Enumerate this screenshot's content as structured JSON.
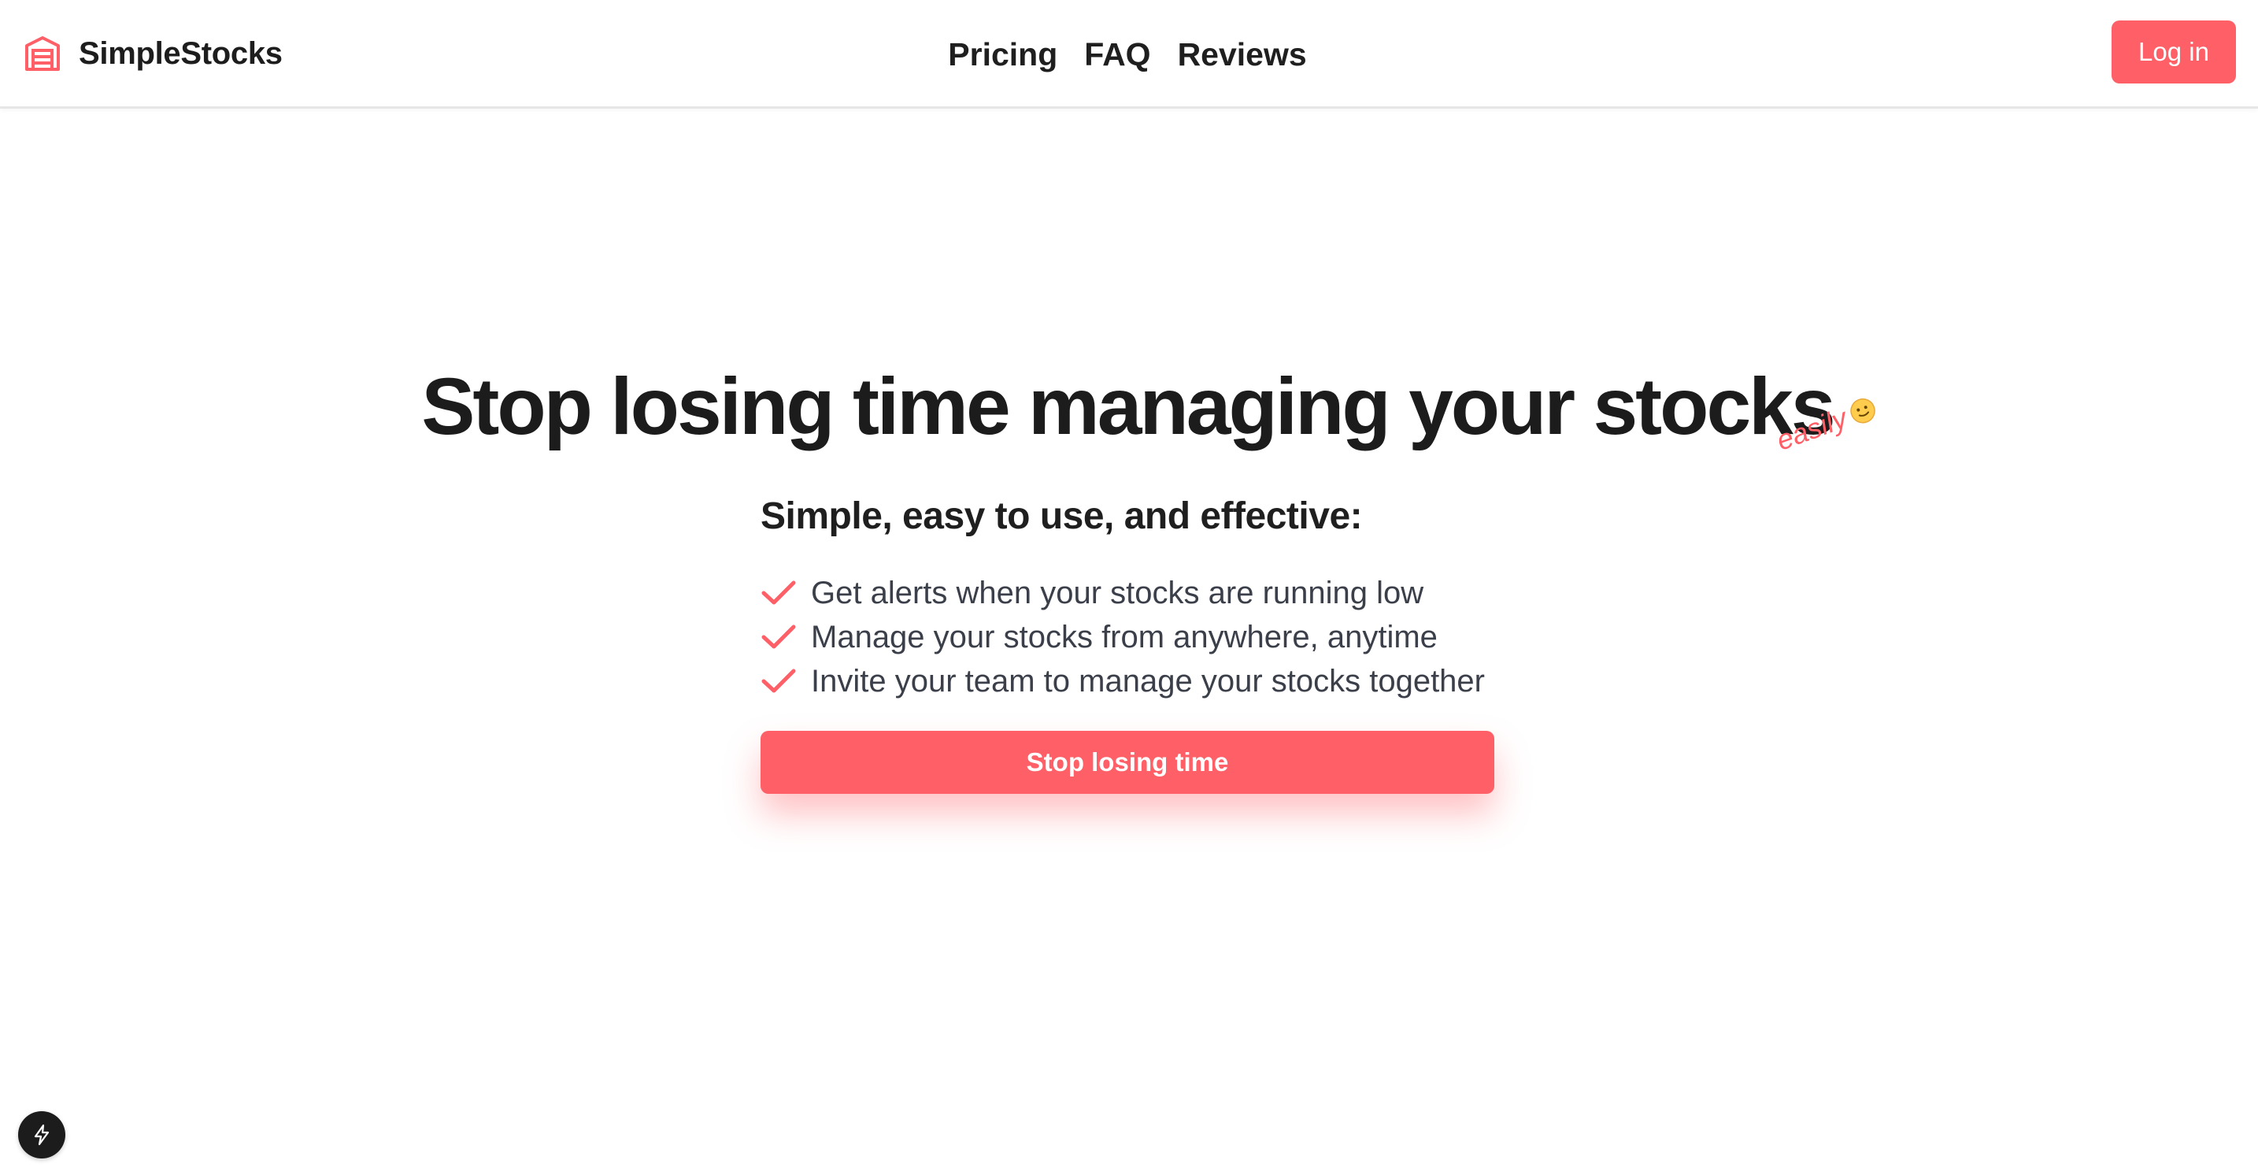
{
  "header": {
    "brand_name": "SimpleStocks",
    "brand_icon": "warehouse-icon",
    "nav": [
      {
        "label": "Pricing"
      },
      {
        "label": "FAQ"
      },
      {
        "label": "Reviews"
      }
    ],
    "login_label": "Log in"
  },
  "hero": {
    "title": "Stop losing time managing your stocks",
    "annotation": "easily",
    "annotation_emoji": "slightly-smiling-face-icon",
    "subtitle": "Simple, easy to use, and effective:",
    "features": [
      {
        "text": "Get alerts when your stocks are running low"
      },
      {
        "text": "Manage your stocks from anywhere, anytime"
      },
      {
        "text": "Invite your team to manage your stocks together"
      }
    ],
    "cta_label": "Stop losing time"
  },
  "floating": {
    "icon": "lightning-bolt-icon"
  },
  "colors": {
    "accent": "#ff5f66",
    "text": "#1f1f1f",
    "muted_text": "#3b3f4a",
    "badge_bg": "#1c1c1c"
  }
}
